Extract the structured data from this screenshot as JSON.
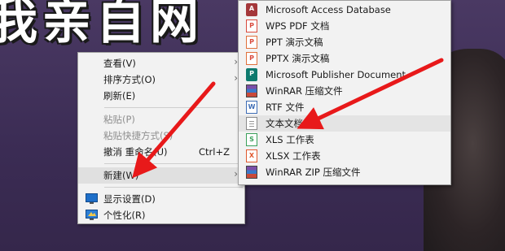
{
  "wallpaper": {
    "banner_text": "我亲自网"
  },
  "context_menu": {
    "items": [
      {
        "label": "查看(V)",
        "has_submenu": true,
        "disabled": false
      },
      {
        "label": "排序方式(O)",
        "has_submenu": true,
        "disabled": false
      },
      {
        "label": "刷新(E)",
        "has_submenu": false,
        "disabled": false
      },
      {
        "label": "粘贴(P)",
        "has_submenu": false,
        "disabled": true
      },
      {
        "label": "粘贴快捷方式(S)",
        "has_submenu": false,
        "disabled": true
      },
      {
        "label": "撤消 重命名(U)",
        "shortcut": "Ctrl+Z",
        "disabled": false
      },
      {
        "label": "新建(W)",
        "has_submenu": true,
        "disabled": false
      },
      {
        "label": "显示设置(D)",
        "icon": "display-settings-icon",
        "disabled": false
      },
      {
        "label": "个性化(R)",
        "icon": "personalize-icon",
        "disabled": false
      }
    ],
    "arrow_glyph": "›"
  },
  "new_submenu": {
    "items": [
      {
        "label": "Microsoft Access Database",
        "icon": "access-db-icon",
        "glyph": "A"
      },
      {
        "label": "WPS PDF 文档",
        "icon": "wps-pdf-icon",
        "glyph": "P"
      },
      {
        "label": "PPT 演示文稿",
        "icon": "ppt-icon",
        "glyph": "P"
      },
      {
        "label": "PPTX 演示文稿",
        "icon": "pptx-icon",
        "glyph": "P"
      },
      {
        "label": "Microsoft Publisher Document",
        "icon": "publisher-icon",
        "glyph": "P"
      },
      {
        "label": "WinRAR 压缩文件",
        "icon": "winrar-icon"
      },
      {
        "label": "RTF 文件",
        "icon": "rtf-icon",
        "glyph": "W"
      },
      {
        "label": "文本文档",
        "icon": "text-document-icon",
        "highlighted": true
      },
      {
        "label": "XLS 工作表",
        "icon": "xls-icon",
        "glyph": "S"
      },
      {
        "label": "XLSX 工作表",
        "icon": "xlsx-icon",
        "glyph": "X"
      },
      {
        "label": "WinRAR ZIP 压缩文件",
        "icon": "winrar-zip-icon"
      }
    ]
  },
  "annotation_color": "#e8191a"
}
